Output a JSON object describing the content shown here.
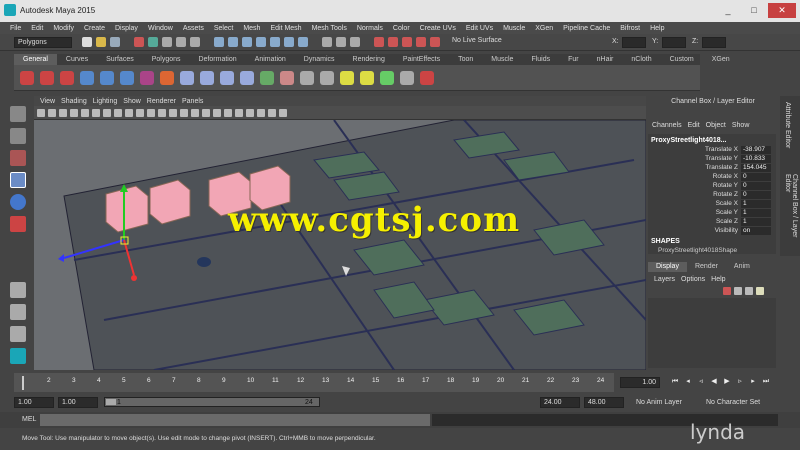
{
  "window": {
    "title": "Autodesk Maya 2015",
    "controls": [
      "_",
      "□",
      "✕"
    ]
  },
  "menubar": [
    "File",
    "Edit",
    "Modify",
    "Create",
    "Display",
    "Window",
    "Assets",
    "Select",
    "Mesh",
    "Edit Mesh",
    "Mesh Tools",
    "Normals",
    "Color",
    "Create UVs",
    "Edit UVs",
    "Muscle",
    "XGen",
    "Pipeline Cache",
    "Bifrost",
    "Help"
  ],
  "statusline": {
    "mode": "Polygons",
    "live_surface": "No Live Surface",
    "xyz_labels": [
      "X:",
      "Y:",
      "Z:"
    ]
  },
  "shelf": {
    "tabs": [
      "General",
      "Curves",
      "Surfaces",
      "Polygons",
      "Deformation",
      "Animation",
      "Dynamics",
      "Rendering",
      "PaintEffects",
      "Toon",
      "Muscle",
      "Fluids",
      "Fur",
      "nHair",
      "nCloth",
      "Custom",
      "XGen"
    ],
    "active": "General"
  },
  "panel_menu": [
    "View",
    "Shading",
    "Lighting",
    "Show",
    "Renderer",
    "Panels"
  ],
  "channel_box": {
    "title": "Channel Box / Layer Editor",
    "menu": [
      "Channels",
      "Edit",
      "Object",
      "Show"
    ],
    "object": "ProxyStreetlight4018...",
    "attributes": [
      {
        "name": "Translate X",
        "value": "-38.907"
      },
      {
        "name": "Translate Y",
        "value": "-10.833"
      },
      {
        "name": "Translate Z",
        "value": "154.045"
      },
      {
        "name": "Rotate X",
        "value": "0"
      },
      {
        "name": "Rotate Y",
        "value": "0"
      },
      {
        "name": "Rotate Z",
        "value": "0"
      },
      {
        "name": "Scale X",
        "value": "1"
      },
      {
        "name": "Scale Y",
        "value": "1"
      },
      {
        "name": "Scale Z",
        "value": "1"
      },
      {
        "name": "Visibility",
        "value": "on"
      }
    ],
    "shapes_label": "SHAPES",
    "shape_name": "ProxyStreetlight4018Shape"
  },
  "side_tabs": [
    "Attribute Editor",
    "Channel Box / Layer Editor"
  ],
  "layer_editor": {
    "tabs": [
      "Display",
      "Render",
      "Anim"
    ],
    "active": "Display",
    "menu": [
      "Layers",
      "Options",
      "Help"
    ]
  },
  "timeline": {
    "ticks": [
      "1",
      "2",
      "3",
      "4",
      "5",
      "6",
      "7",
      "8",
      "9",
      "10",
      "11",
      "12",
      "13",
      "14",
      "15",
      "16",
      "17",
      "18",
      "19",
      "20",
      "21",
      "22",
      "23",
      "24"
    ],
    "current_frame": "1.00"
  },
  "range": {
    "start": "1.00",
    "start_inner": "1.00",
    "slider_start": "1",
    "slider_end": "24",
    "end_inner": "24.00",
    "end": "48.00",
    "anim_layer": "No Anim Layer",
    "character_set": "No Character Set"
  },
  "cmdline": {
    "label": "MEL"
  },
  "helpline": "Move Tool: Use manipulator to move object(s). Use edit mode to change pivot (INSERT). Ctrl+MMB to move perpendicular.",
  "watermark": "www.cgtsj.com",
  "brand": "lynda",
  "colors": {
    "accent": "#1aa6b7",
    "watermark": "#f6f000",
    "crate": "#f4a0b0"
  }
}
